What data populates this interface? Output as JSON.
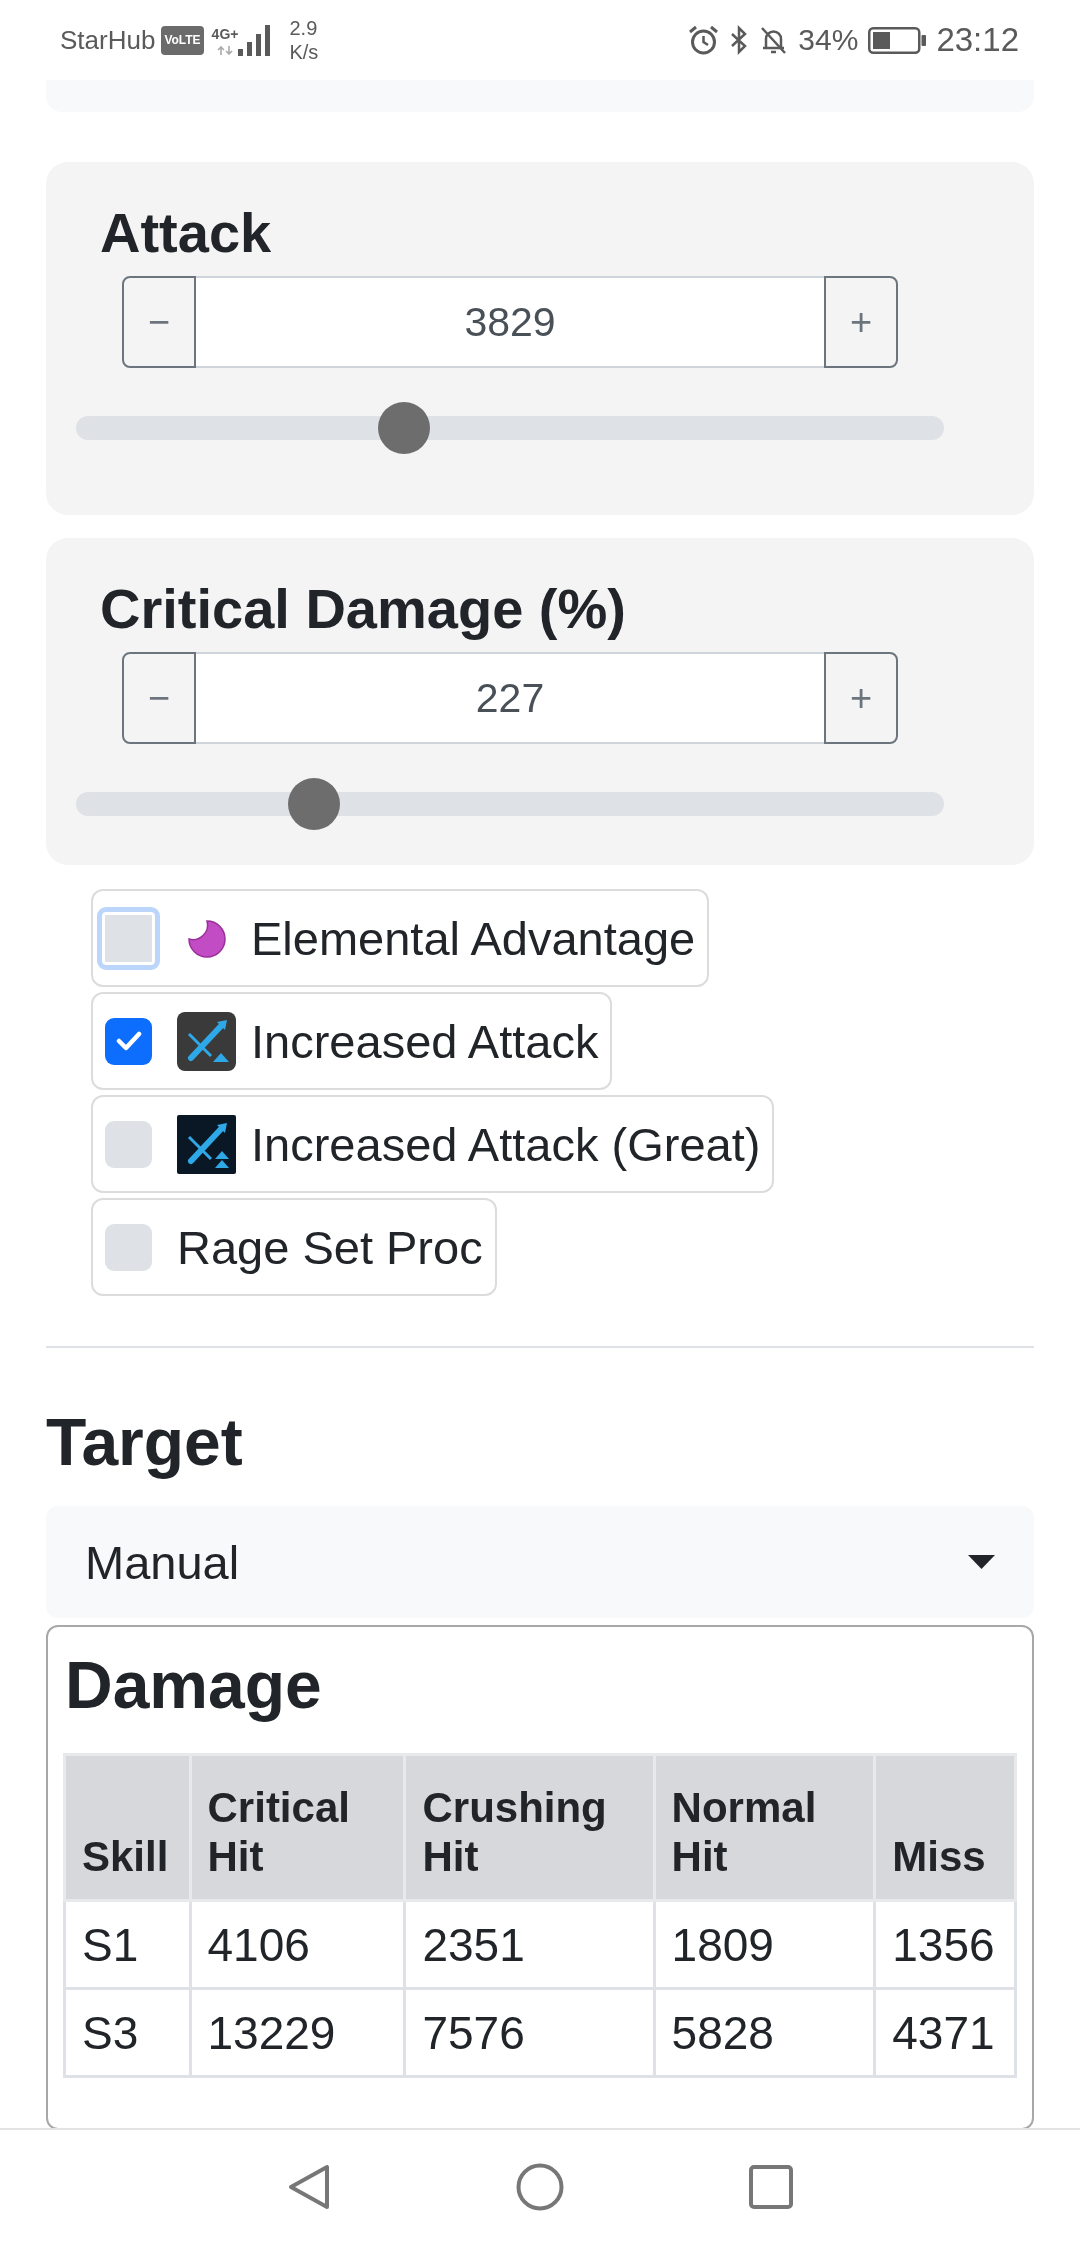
{
  "status_bar": {
    "carrier": "StarHub",
    "volte": "VoLTE",
    "network": "4G+",
    "speed": "2.9",
    "speed_unit": "K/s",
    "battery": "34%",
    "time": "23:12"
  },
  "stats": [
    {
      "label": "Attack",
      "decrement": "−",
      "value": "3829",
      "increment": "+",
      "level": 0.37
    },
    {
      "label": "Critical Damage (%)",
      "decrement": "−",
      "value": "227",
      "increment": "+",
      "level": 0.26
    }
  ],
  "buffs": [
    {
      "kind": "element",
      "label": "Elemental Advantage",
      "checked": false,
      "focused": true
    },
    {
      "kind": "buff",
      "label": "Increased Attack",
      "checked": true,
      "focused": false
    },
    {
      "kind": "greatbuff",
      "label": "Increased Attack (Great)",
      "checked": false,
      "focused": false
    },
    {
      "kind": "plain",
      "label": "Rage Set Proc",
      "checked": false,
      "focused": false
    }
  ],
  "target": {
    "heading": "Target",
    "select": {
      "value": "Manual"
    }
  },
  "damage": {
    "title": "Damage",
    "table": {
      "columns": [
        "Skill",
        "Critical Hit",
        "Crushing Hit",
        "Normal Hit",
        "Miss"
      ],
      "rows": [
        [
          "S1",
          "4106",
          "2351",
          "1809",
          "1356"
        ],
        [
          "S3",
          "13229",
          "7576",
          "5828",
          "4371"
        ]
      ]
    }
  }
}
